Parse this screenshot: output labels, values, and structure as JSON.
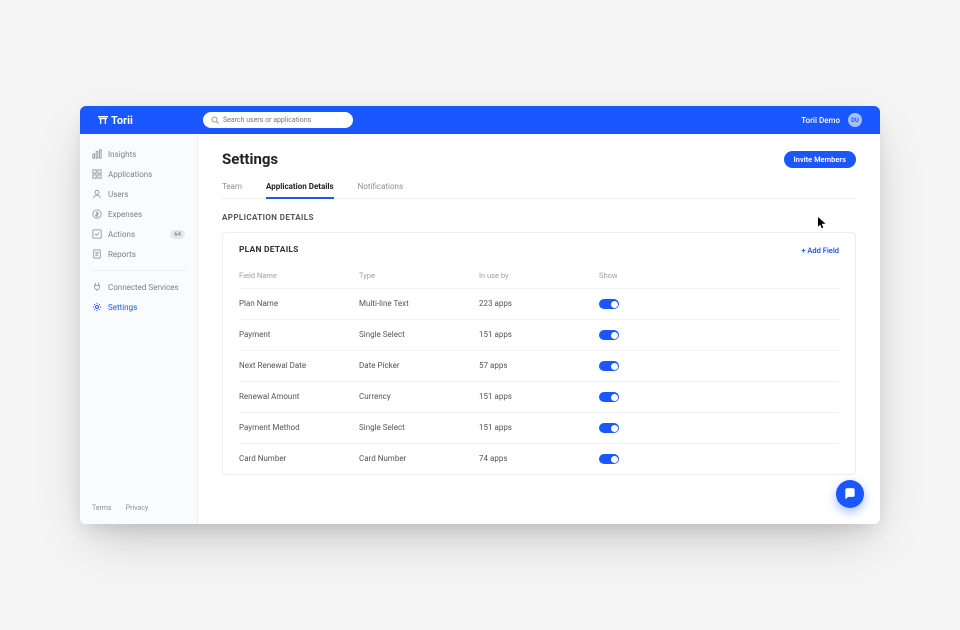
{
  "brand": "Torii",
  "search": {
    "placeholder": "Search users or applications"
  },
  "workspace": "Torii Demo",
  "avatar_initials": "DU",
  "sidebar": {
    "items": [
      {
        "label": "Insights"
      },
      {
        "label": "Applications"
      },
      {
        "label": "Users"
      },
      {
        "label": "Expenses"
      },
      {
        "label": "Actions",
        "badge": "64"
      },
      {
        "label": "Reports"
      }
    ],
    "secondary": [
      {
        "label": "Connected Services"
      },
      {
        "label": "Settings"
      }
    ],
    "footer": {
      "terms": "Terms",
      "privacy": "Privacy"
    }
  },
  "page": {
    "title": "Settings",
    "invite_label": "Invite Members",
    "tabs": [
      {
        "label": "Team"
      },
      {
        "label": "Application Details"
      },
      {
        "label": "Notifications"
      }
    ],
    "section_label": "APPLICATION DETAILS"
  },
  "panel": {
    "title": "PLAN DETAILS",
    "add_field_label": "+ Add Field",
    "headers": {
      "field": "Field Name",
      "type": "Type",
      "inuse": "In use by",
      "show": "Show"
    },
    "rows": [
      {
        "field": "Plan Name",
        "type": "Multi-line Text",
        "inuse": "223 apps",
        "show": true
      },
      {
        "field": "Payment",
        "type": "Single Select",
        "inuse": "151 apps",
        "show": true
      },
      {
        "field": "Next Renewal Date",
        "type": "Date Picker",
        "inuse": "57 apps",
        "show": true
      },
      {
        "field": "Renewal Amount",
        "type": "Currency",
        "inuse": "151 apps",
        "show": true
      },
      {
        "field": "Payment Method",
        "type": "Single Select",
        "inuse": "151 apps",
        "show": true
      },
      {
        "field": "Card Number",
        "type": "Card Number",
        "inuse": "74 apps",
        "show": true
      }
    ]
  }
}
